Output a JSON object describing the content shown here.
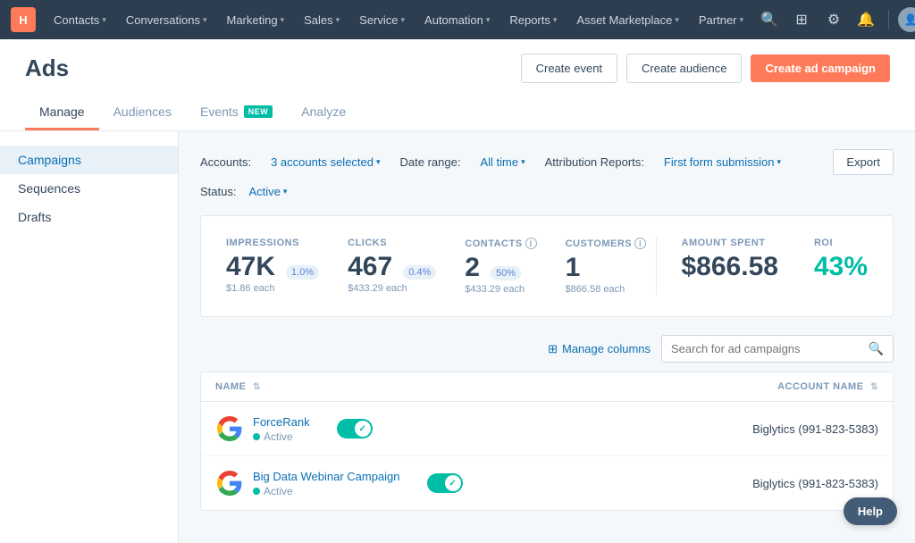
{
  "topnav": {
    "logo": "H",
    "items": [
      {
        "label": "Contacts",
        "id": "contacts"
      },
      {
        "label": "Conversations",
        "id": "conversations"
      },
      {
        "label": "Marketing",
        "id": "marketing"
      },
      {
        "label": "Sales",
        "id": "sales"
      },
      {
        "label": "Service",
        "id": "service"
      },
      {
        "label": "Automation",
        "id": "automation"
      },
      {
        "label": "Reports",
        "id": "reports"
      },
      {
        "label": "Asset Marketplace",
        "id": "asset-marketplace"
      },
      {
        "label": "Partner",
        "id": "partner"
      }
    ]
  },
  "page": {
    "title": "Ads",
    "tabs": [
      {
        "label": "Manage",
        "id": "manage",
        "active": true,
        "badge": null
      },
      {
        "label": "Audiences",
        "id": "audiences",
        "active": false,
        "badge": null
      },
      {
        "label": "Events",
        "id": "events",
        "active": false,
        "badge": "NEW"
      },
      {
        "label": "Analyze",
        "id": "analyze",
        "active": false,
        "badge": null
      }
    ],
    "header_buttons": {
      "create_event": "Create event",
      "create_audience": "Create audience",
      "create_campaign": "Create ad campaign"
    }
  },
  "sidebar": {
    "items": [
      {
        "label": "Campaigns",
        "id": "campaigns",
        "active": true
      },
      {
        "label": "Sequences",
        "id": "sequences",
        "active": false
      },
      {
        "label": "Drafts",
        "id": "drafts",
        "active": false
      }
    ]
  },
  "filters": {
    "accounts_label": "Accounts:",
    "accounts_value": "3 accounts selected",
    "date_label": "Date range:",
    "date_value": "All time",
    "attribution_label": "Attribution Reports:",
    "attribution_value": "First form submission",
    "status_label": "Status:",
    "status_value": "Active",
    "export_label": "Export"
  },
  "stats": {
    "impressions": {
      "label": "IMPRESSIONS",
      "value": "47K",
      "badge": "1.0%",
      "sub": "$1.86 each"
    },
    "clicks": {
      "label": "CLICKS",
      "value": "467",
      "badge": "0.4%",
      "sub": "$433.29 each"
    },
    "contacts": {
      "label": "CONTACTS",
      "value": "2",
      "badge": "50%",
      "sub": "$433.29 each",
      "has_info": true
    },
    "customers": {
      "label": "CUSTOMERS",
      "value": "1",
      "sub": "$866.58 each",
      "has_info": true
    },
    "amount_spent": {
      "label": "AMOUNT SPENT",
      "value": "$866.58"
    },
    "roi": {
      "label": "ROI",
      "value": "43%"
    }
  },
  "table_toolbar": {
    "manage_columns": "Manage columns",
    "search_placeholder": "Search for ad campaigns"
  },
  "table": {
    "columns": [
      {
        "label": "NAME",
        "sortable": true
      },
      {
        "label": "ACCOUNT NAME",
        "sortable": true
      }
    ],
    "rows": [
      {
        "id": "forcerank",
        "name": "ForceRank",
        "status": "Active",
        "account": "Biglytics (991-823-5383)",
        "logo_color": "#4285f4",
        "logo_type": "google"
      },
      {
        "id": "big-data-webinar",
        "name": "Big Data Webinar Campaign",
        "status": "Active",
        "account": "Biglytics (991-823-5383)",
        "logo_color": "#4285f4",
        "logo_type": "google"
      }
    ]
  },
  "help": {
    "label": "Help"
  }
}
